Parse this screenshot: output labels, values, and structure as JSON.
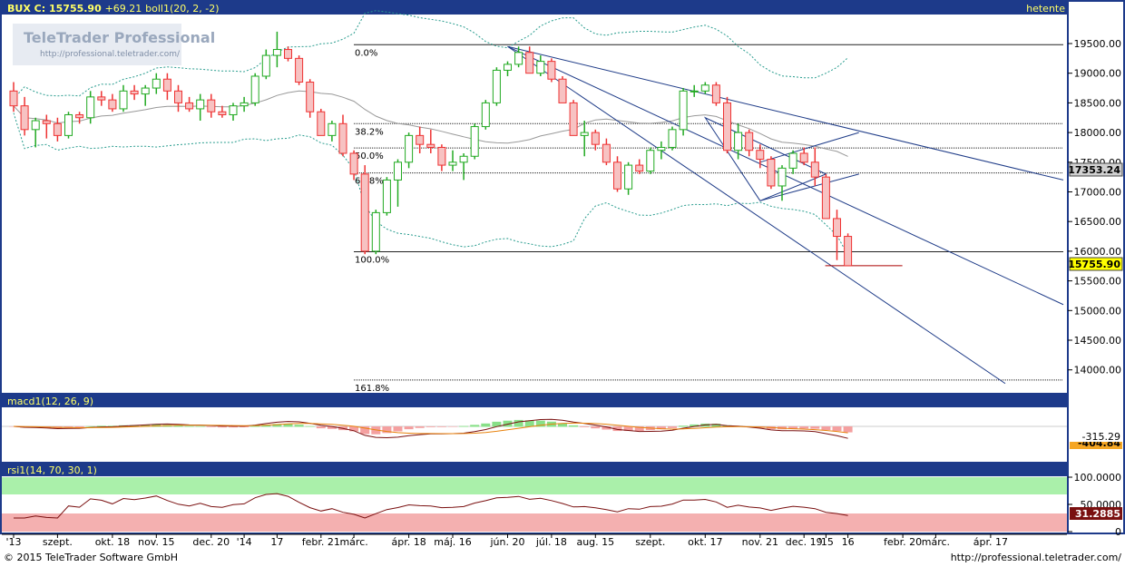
{
  "header": {
    "symbol": "BUX",
    "close_label": "C:",
    "close_value": "15755.90",
    "change": "+69.21",
    "indicator": "boll1(20, 2, -2)",
    "period": "hetente"
  },
  "watermark": {
    "brand": "TeleTrader Professional",
    "url": "http://professional.teletrader.com/"
  },
  "price_axis": {
    "ticks": [
      "19500.00",
      "19000.00",
      "18500.00",
      "18000.00",
      "17500.00",
      "17000.00",
      "16500.00",
      "16000.00",
      "15500.00",
      "15000.00",
      "14500.00",
      "14000.00"
    ],
    "tick_values": [
      19500,
      19000,
      18500,
      18000,
      17500,
      17000,
      16500,
      16000,
      15500,
      15000,
      14500,
      14000
    ],
    "marker_level": "17353.24",
    "last_price": "15755.90"
  },
  "fibonacci": [
    {
      "label": "0.0%",
      "value": 19480
    },
    {
      "label": "38.2%",
      "value": 18150
    },
    {
      "label": "50.0%",
      "value": 17740
    },
    {
      "label": "61.8%",
      "value": 17320
    },
    {
      "label": "100.0%",
      "value": 15990
    },
    {
      "label": "161.8%",
      "value": 13830
    }
  ],
  "macd": {
    "label": "macd1(12, 26, 9)",
    "value1": "-315.29",
    "value2": "-404.84"
  },
  "rsi": {
    "label": "rsi1(14, 70, 30, 1)",
    "ticks": [
      "100.0000",
      "50.0000",
      "0"
    ],
    "tick_values": [
      100,
      50,
      0
    ],
    "value": "31.2885"
  },
  "x_axis": {
    "labels": [
      "'13",
      "szept.",
      "okt. 18",
      "nov. 15",
      "dec. 20",
      "'14",
      "17",
      "febr. 21",
      "márc.",
      "ápr. 18",
      "máj. 16",
      "jún. 20",
      "júl. 18",
      "aug. 15",
      "szept.",
      "okt. 17",
      "nov. 21",
      "dec. 19",
      "'15",
      "16",
      "febr. 20",
      "márc.",
      "ápr. 17"
    ],
    "week_index": [
      0,
      4,
      9,
      13,
      18,
      21,
      24,
      28,
      31,
      36,
      40,
      45,
      49,
      53,
      58,
      63,
      68,
      72,
      74,
      76,
      81,
      84,
      89
    ]
  },
  "footer": {
    "copyright": "© 2015 TeleTrader Software GmbH",
    "url": "http://professional.teletrader.com/"
  },
  "colors": {
    "header_bg": "#1d3a8a",
    "header_text": "#ffff66",
    "up": "#22aa22",
    "down": "#ee3333",
    "bollinger": "#2a9d8f",
    "trendline": "#1f3c88",
    "macd_line": "#7a1010",
    "signal_line": "#e8820c",
    "rsi_line": "#7a1010",
    "overbought": "#aaf0aa",
    "oversold": "#f4b0b0"
  },
  "chart_data": {
    "type": "candlestick",
    "title": "BUX C: 15755.90 +69.21 boll1(20, 2, -2)",
    "interval": "weekly",
    "ylim": [
      13750,
      19850
    ],
    "weeks": [
      0,
      1,
      2,
      3,
      4,
      5,
      6,
      7,
      8,
      9,
      10,
      11,
      12,
      13,
      14,
      15,
      16,
      17,
      18,
      19,
      20,
      21,
      22,
      23,
      24,
      25,
      26,
      27,
      28,
      29,
      30,
      31,
      32,
      33,
      34,
      35,
      36,
      37,
      38,
      39,
      40,
      41,
      42,
      43,
      44,
      45,
      46,
      47,
      48,
      49,
      50,
      51,
      52,
      53,
      54,
      55,
      56,
      57,
      58,
      59,
      60,
      61,
      62,
      63,
      64,
      65,
      66,
      67,
      68,
      69,
      70,
      71,
      72,
      73,
      74,
      75,
      76
    ],
    "open": [
      18700,
      18450,
      18050,
      18200,
      18150,
      17950,
      18300,
      18250,
      18600,
      18550,
      18400,
      18700,
      18650,
      18750,
      18900,
      18700,
      18500,
      18400,
      18550,
      18350,
      18300,
      18450,
      18500,
      18950,
      19300,
      19400,
      19250,
      18850,
      18350,
      17950,
      18150,
      17650,
      17300,
      16000,
      16650,
      17200,
      17500,
      17950,
      17800,
      17750,
      17450,
      17500,
      17600,
      18100,
      18500,
      19050,
      19150,
      19350,
      19000,
      19200,
      18900,
      18500,
      17950,
      18000,
      17800,
      17500,
      17050,
      17450,
      17350,
      17700,
      17750,
      18050,
      18700,
      18700,
      18800,
      18500,
      17700,
      18000,
      17700,
      17550,
      17100,
      17400,
      17650,
      17500,
      17250,
      16550,
      16250
    ],
    "close": [
      18450,
      18050,
      18200,
      18150,
      17950,
      18300,
      18250,
      18600,
      18550,
      18400,
      18700,
      18650,
      18750,
      18900,
      18700,
      18500,
      18400,
      18550,
      18350,
      18300,
      18450,
      18500,
      18950,
      19300,
      19400,
      19250,
      18850,
      18350,
      17950,
      18150,
      17650,
      17300,
      16000,
      16650,
      17200,
      17500,
      17950,
      17800,
      17750,
      17450,
      17500,
      17600,
      18100,
      18500,
      19050,
      19150,
      19350,
      19000,
      19200,
      18900,
      18500,
      17950,
      18000,
      17800,
      17500,
      17050,
      17450,
      17350,
      17700,
      17750,
      18050,
      18700,
      18700,
      18800,
      18500,
      17700,
      18000,
      17700,
      17550,
      17100,
      17400,
      17650,
      17500,
      17250,
      16550,
      16250,
      15755
    ],
    "high": [
      18850,
      18600,
      18250,
      18300,
      18250,
      18350,
      18350,
      18700,
      18700,
      18650,
      18800,
      18800,
      18800,
      19000,
      19000,
      18800,
      18600,
      18650,
      18650,
      18450,
      18500,
      18600,
      19000,
      19400,
      19700,
      19450,
      19300,
      18900,
      18400,
      18200,
      18300,
      17700,
      17450,
      16700,
      17250,
      17550,
      18000,
      18100,
      18050,
      17800,
      17700,
      17650,
      18150,
      18550,
      19100,
      19200,
      19450,
      19450,
      19300,
      19250,
      18950,
      18550,
      18200,
      18050,
      17900,
      17600,
      17500,
      17550,
      17750,
      17850,
      18100,
      18750,
      18800,
      18850,
      18850,
      18600,
      18150,
      18050,
      17800,
      17600,
      17450,
      17700,
      17750,
      17750,
      17300,
      16700,
      16300
    ],
    "low": [
      18350,
      17950,
      17750,
      17900,
      17850,
      17900,
      18150,
      18150,
      18450,
      18350,
      18350,
      18550,
      18450,
      18650,
      18550,
      18350,
      18350,
      18200,
      18250,
      18250,
      18200,
      18350,
      18450,
      18900,
      19100,
      19200,
      18800,
      18250,
      17950,
      17850,
      17600,
      17200,
      15950,
      15950,
      16600,
      16750,
      17400,
      17650,
      17650,
      17350,
      17350,
      17200,
      17550,
      18050,
      18450,
      18950,
      19100,
      19000,
      18950,
      18850,
      18500,
      17950,
      17600,
      17700,
      17450,
      17000,
      16950,
      17300,
      17300,
      17550,
      17700,
      17950,
      18600,
      18650,
      18450,
      17650,
      17550,
      17600,
      17400,
      17050,
      16850,
      17300,
      17450,
      17100,
      17050,
      15850,
      16200
    ]
  }
}
